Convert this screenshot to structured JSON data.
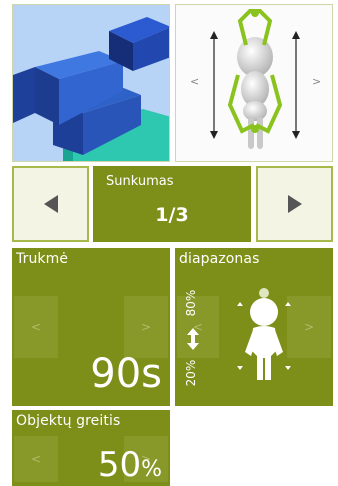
{
  "thumbnails": {
    "left": {
      "icon": "blocks-3d-image"
    },
    "right": {
      "icon": "figure-arms-up-image",
      "left_arrow": "<",
      "right_arrow": ">"
    }
  },
  "difficulty": {
    "label": "Sunkumas",
    "value": "1/3",
    "prev_icon": "triangle-left",
    "next_icon": "triangle-right"
  },
  "duration": {
    "label": "Trukmė",
    "value": "90",
    "unit": "s",
    "prev": "<",
    "next": ">"
  },
  "range": {
    "label": "diapazonas",
    "max": "80%",
    "min": "20%",
    "prev": "<",
    "next": ">"
  },
  "speed": {
    "label": "Objektų greitis",
    "value": "50",
    "unit": "%",
    "prev": "<",
    "next": ">"
  },
  "colors": {
    "tile": "#7d8f18",
    "tile_light": "#f4f4e4",
    "border": "#a9b84a"
  }
}
